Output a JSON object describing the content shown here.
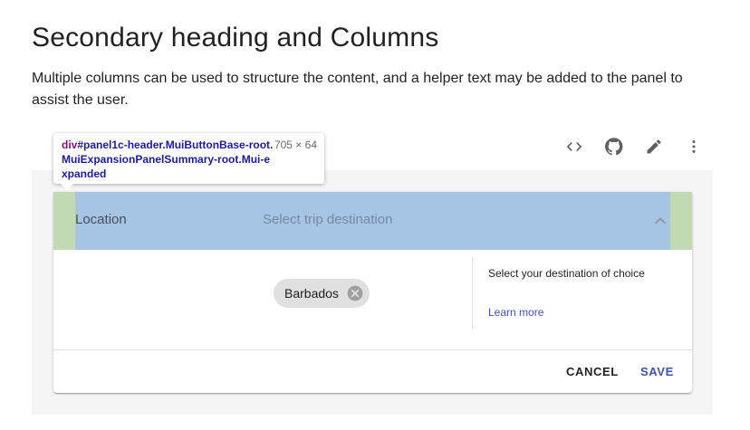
{
  "header": {
    "title": "Secondary heading and Columns",
    "description": "Multiple columns can be used to structure the content, and a helper text may be added to the panel to assist the user."
  },
  "toolbar": {
    "buttons": [
      {
        "icon": "code-icon"
      },
      {
        "icon": "github-icon"
      },
      {
        "icon": "edit-icon"
      },
      {
        "icon": "more-vert-icon"
      }
    ]
  },
  "inspector_tooltip": {
    "tag": "div",
    "selector": "#panel1c-header.MuiButtonBase-root.MuiExpansionPanelSummary-root.Mui-expanded",
    "size": "705 × 64"
  },
  "panel": {
    "summary": {
      "heading": "Location",
      "secondary_heading": "Select trip destination"
    },
    "details": {
      "chip_label": "Barbados",
      "helper_text": "Select your destination of choice",
      "helper_link": "Learn more"
    },
    "actions": {
      "cancel_label": "CANCEL",
      "save_label": "SAVE"
    }
  },
  "colors": {
    "primary": "#3f51b5",
    "highlight_content": "#a6c4e4",
    "highlight_padding": "#c2dab4"
  }
}
